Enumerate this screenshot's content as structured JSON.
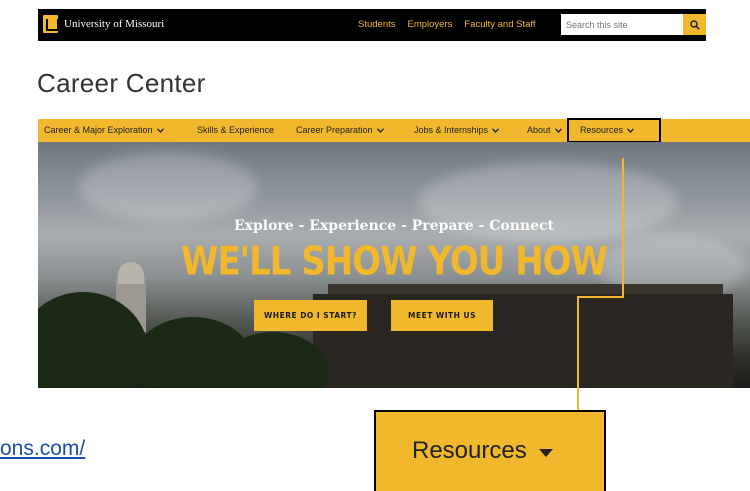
{
  "topbar": {
    "brand": "University of Missouri",
    "links": [
      "Students",
      "Employers",
      "Faculty and Staff"
    ],
    "search_placeholder": "Search this site"
  },
  "page_title": "Career Center",
  "nav": {
    "items": [
      {
        "label": "Career & Major Exploration",
        "dropdown": true
      },
      {
        "label": "Skills & Experience",
        "dropdown": false
      },
      {
        "label": "Career Preparation",
        "dropdown": true
      },
      {
        "label": "Jobs & Internships",
        "dropdown": true
      },
      {
        "label": "About",
        "dropdown": true
      },
      {
        "label": "Resources",
        "dropdown": true
      }
    ]
  },
  "hero": {
    "tagline": "Explore - Experience - Prepare - Connect",
    "heading": "WE'LL SHOW YOU HOW",
    "buttons": [
      "WHERE DO I START?",
      "MEET WITH US"
    ]
  },
  "callout": {
    "label": "Resources"
  },
  "link_fragment": "ons.com/",
  "colors": {
    "gold": "#f1b82d",
    "black": "#000000",
    "link": "#1f4ea8"
  }
}
